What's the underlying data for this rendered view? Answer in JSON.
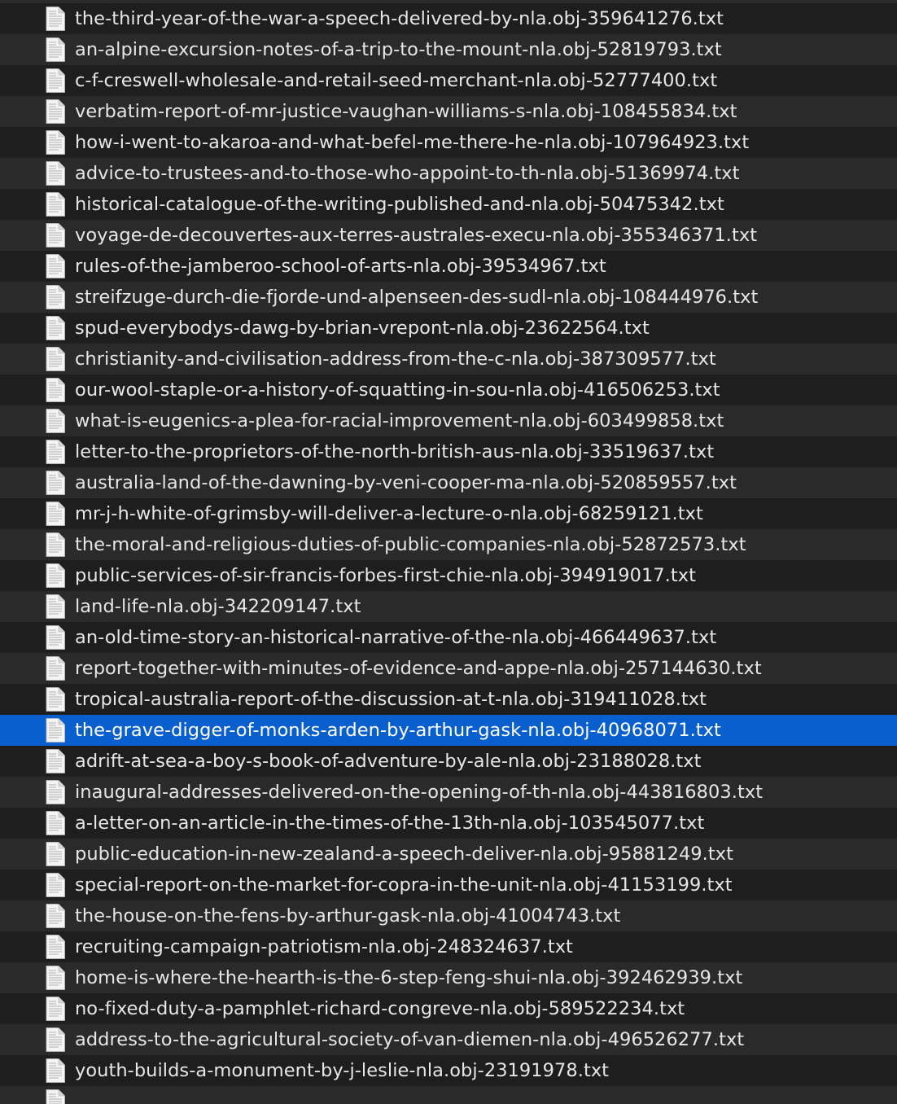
{
  "finder": {
    "row_colors": {
      "even": "#1e1e1e",
      "odd": "#2a2a2a",
      "selected": "#0a5fcf"
    },
    "selected_file": "the-grave-digger-of-monks-arden-by-arthur-gask-nla.obj-40968071.txt",
    "items": [
      {
        "name": "the-third-year-of-the-war-a-speech-delivered-by-nla.obj-359641276.txt",
        "icon": "text-document-icon"
      },
      {
        "name": "an-alpine-excursion-notes-of-a-trip-to-the-mount-nla.obj-52819793.txt",
        "icon": "text-document-icon"
      },
      {
        "name": "c-f-creswell-wholesale-and-retail-seed-merchant-nla.obj-52777400.txt",
        "icon": "text-document-icon"
      },
      {
        "name": "verbatim-report-of-mr-justice-vaughan-williams-s-nla.obj-108455834.txt",
        "icon": "text-document-icon"
      },
      {
        "name": "how-i-went-to-akaroa-and-what-befel-me-there-he-nla.obj-107964923.txt",
        "icon": "text-document-icon"
      },
      {
        "name": "advice-to-trustees-and-to-those-who-appoint-to-th-nla.obj-51369974.txt",
        "icon": "text-document-icon"
      },
      {
        "name": "historical-catalogue-of-the-writing-published-and-nla.obj-50475342.txt",
        "icon": "text-document-icon"
      },
      {
        "name": "voyage-de-decouvertes-aux-terres-australes-execu-nla.obj-355346371.txt",
        "icon": "text-document-icon"
      },
      {
        "name": "rules-of-the-jamberoo-school-of-arts-nla.obj-39534967.txt",
        "icon": "text-document-icon"
      },
      {
        "name": "streifzuge-durch-die-fjorde-und-alpenseen-des-sudl-nla.obj-108444976.txt",
        "icon": "text-document-icon"
      },
      {
        "name": "spud-everybodys-dawg-by-brian-vrepont-nla.obj-23622564.txt",
        "icon": "text-document-icon"
      },
      {
        "name": "christianity-and-civilisation-address-from-the-c-nla.obj-387309577.txt",
        "icon": "text-document-icon"
      },
      {
        "name": "our-wool-staple-or-a-history-of-squatting-in-sou-nla.obj-416506253.txt",
        "icon": "text-document-icon"
      },
      {
        "name": "what-is-eugenics-a-plea-for-racial-improvement-nla.obj-603499858.txt",
        "icon": "text-document-icon"
      },
      {
        "name": "letter-to-the-proprietors-of-the-north-british-aus-nla.obj-33519637.txt",
        "icon": "text-document-icon"
      },
      {
        "name": "australia-land-of-the-dawning-by-veni-cooper-ma-nla.obj-520859557.txt",
        "icon": "text-document-icon"
      },
      {
        "name": "mr-j-h-white-of-grimsby-will-deliver-a-lecture-o-nla.obj-68259121.txt",
        "icon": "text-document-icon"
      },
      {
        "name": "the-moral-and-religious-duties-of-public-companies-nla.obj-52872573.txt",
        "icon": "text-document-icon"
      },
      {
        "name": "public-services-of-sir-francis-forbes-first-chie-nla.obj-394919017.txt",
        "icon": "text-document-icon"
      },
      {
        "name": "land-life-nla.obj-342209147.txt",
        "icon": "text-document-icon"
      },
      {
        "name": "an-old-time-story-an-historical-narrative-of-the-nla.obj-466449637.txt",
        "icon": "text-document-icon"
      },
      {
        "name": "report-together-with-minutes-of-evidence-and-appe-nla.obj-257144630.txt",
        "icon": "text-document-icon"
      },
      {
        "name": "tropical-australia-report-of-the-discussion-at-t-nla.obj-319411028.txt",
        "icon": "text-document-icon"
      },
      {
        "name": "the-grave-digger-of-monks-arden-by-arthur-gask-nla.obj-40968071.txt",
        "icon": "text-document-icon",
        "selected": true
      },
      {
        "name": "adrift-at-sea-a-boy-s-book-of-adventure-by-ale-nla.obj-23188028.txt",
        "icon": "text-document-icon"
      },
      {
        "name": "inaugural-addresses-delivered-on-the-opening-of-th-nla.obj-443816803.txt",
        "icon": "text-document-icon"
      },
      {
        "name": "a-letter-on-an-article-in-the-times-of-the-13th-nla.obj-103545077.txt",
        "icon": "text-document-icon"
      },
      {
        "name": "public-education-in-new-zealand-a-speech-deliver-nla.obj-95881249.txt",
        "icon": "text-document-icon"
      },
      {
        "name": "special-report-on-the-market-for-copra-in-the-unit-nla.obj-41153199.txt",
        "icon": "text-document-icon"
      },
      {
        "name": "the-house-on-the-fens-by-arthur-gask-nla.obj-41004743.txt",
        "icon": "text-document-icon"
      },
      {
        "name": "recruiting-campaign-patriotism-nla.obj-248324637.txt",
        "icon": "text-document-icon"
      },
      {
        "name": "home-is-where-the-hearth-is-the-6-step-feng-shui-nla.obj-392462939.txt",
        "icon": "text-document-icon"
      },
      {
        "name": "no-fixed-duty-a-pamphlet-richard-congreve-nla.obj-589522234.txt",
        "icon": "text-document-icon"
      },
      {
        "name": "address-to-the-agricultural-society-of-van-diemen-nla.obj-496526277.txt",
        "icon": "text-document-icon"
      },
      {
        "name": "youth-builds-a-monument-by-j-leslie-nla.obj-23191978.txt",
        "icon": "text-document-icon"
      },
      {
        "name": "",
        "icon": "text-document-icon"
      }
    ]
  }
}
